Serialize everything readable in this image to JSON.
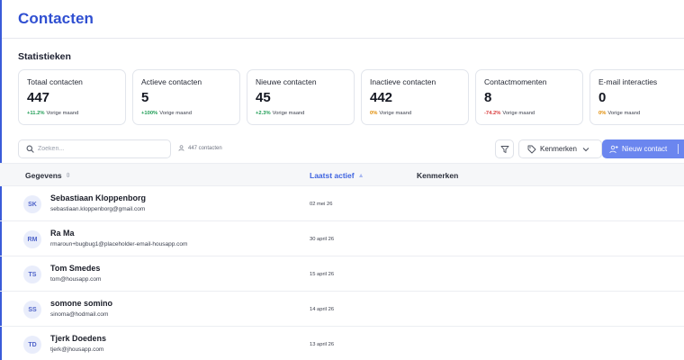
{
  "page": {
    "title": "Contacten"
  },
  "stats": {
    "title": "Statistieken",
    "cards": [
      {
        "label": "Totaal contacten",
        "value": "447",
        "trend": "+11.2%",
        "trend_type": "up",
        "sub": "Vorige maand"
      },
      {
        "label": "Actieve contacten",
        "value": "5",
        "trend": "+100%",
        "trend_type": "up",
        "sub": "Vorige maand"
      },
      {
        "label": "Nieuwe contacten",
        "value": "45",
        "trend": "+2.3%",
        "trend_type": "up",
        "sub": "Vorige maand"
      },
      {
        "label": "Inactieve contacten",
        "value": "442",
        "trend": "0%",
        "trend_type": "neutral",
        "sub": "Vorige maand"
      },
      {
        "label": "Contactmomenten",
        "value": "8",
        "trend": "-74.2%",
        "trend_type": "down",
        "sub": "Vorige maand"
      },
      {
        "label": "E-mail interacties",
        "value": "0",
        "trend": "0%",
        "trend_type": "neutral",
        "sub": "Vorige maand"
      }
    ]
  },
  "toolbar": {
    "search_placeholder": "Zoeken...",
    "count": "447 contacten",
    "tags_label": "Kenmerken",
    "new_label": "Nieuw contact"
  },
  "table": {
    "columns": [
      "Gegevens",
      "Laatst actief",
      "Kenmerken"
    ],
    "rows": [
      {
        "initials": "SK",
        "name": "Sebastiaan Kloppenborg",
        "email": "sebastiaan.kloppenborg@gmail.com",
        "last_active": "02 mei 26"
      },
      {
        "initials": "RM",
        "name": "Ra Ma",
        "email": "rmaroun+bugbug1@placeholder-email-housapp.com",
        "last_active": "30 april 26"
      },
      {
        "initials": "TS",
        "name": "Tom Smedes",
        "email": "tom@housapp.com",
        "last_active": "15 april 26"
      },
      {
        "initials": "SS",
        "name": "somone somino",
        "email": "sinoma@hodmail.com",
        "last_active": "14 april 26"
      },
      {
        "initials": "TD",
        "name": "Tjerk Doedens",
        "email": "tjerk@jhousapp.com",
        "last_active": "13 april 26"
      }
    ]
  },
  "colors": {
    "accent": "#2f4fd1",
    "button": "#6b86ef",
    "up": "#1f9d55",
    "down": "#d83a3a",
    "neutral": "#e08a00"
  }
}
